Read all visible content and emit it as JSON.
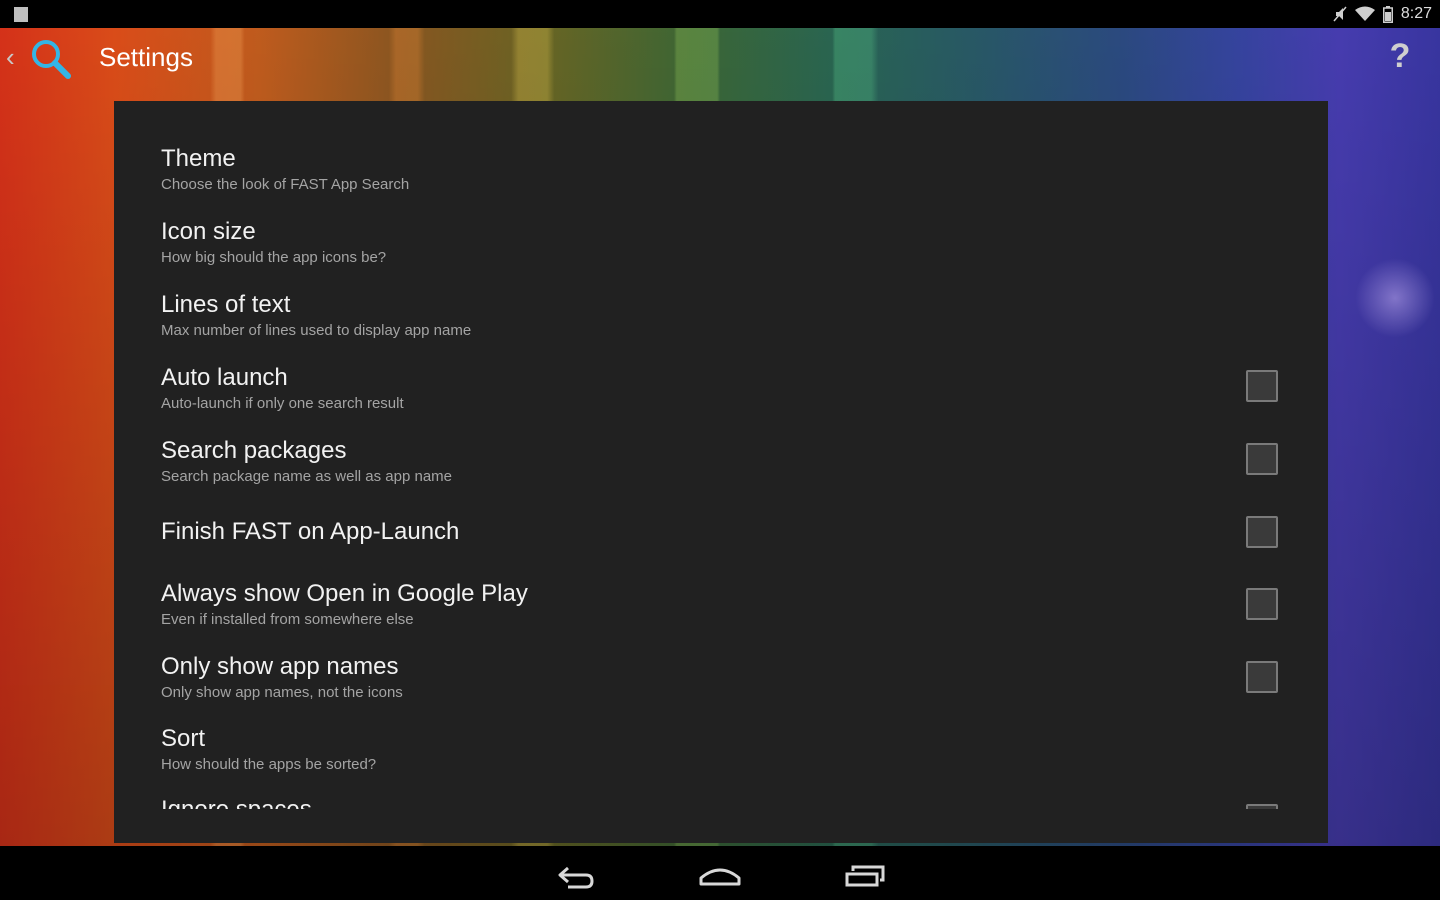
{
  "status_bar": {
    "time": "8:27",
    "icons": [
      "notification-icon",
      "mute-icon",
      "wifi-icon",
      "battery-icon"
    ]
  },
  "action_bar": {
    "up_icon": "chevron-left-icon",
    "app_icon": "search-icon",
    "title": "Settings",
    "help_label": "?"
  },
  "preferences": [
    {
      "title": "Theme",
      "summary": "Choose the look of FAST App Search",
      "checkbox": false
    },
    {
      "title": "Icon size",
      "summary": "How big should the app icons be?",
      "checkbox": false
    },
    {
      "title": "Lines of text",
      "summary": "Max number of lines used to display app name",
      "checkbox": false
    },
    {
      "title": "Auto launch",
      "summary": "Auto-launch if only one search result",
      "checkbox": true,
      "checked": false
    },
    {
      "title": "Search packages",
      "summary": "Search package name as well as app name",
      "checkbox": true,
      "checked": false
    },
    {
      "title": "Finish FAST on App-Launch",
      "summary": "",
      "checkbox": true,
      "checked": false
    },
    {
      "title": "Always show Open in Google Play",
      "summary": "Even if installed from somewhere else",
      "checkbox": true,
      "checked": false
    },
    {
      "title": "Only show app names",
      "summary": "Only show app names, not the icons",
      "checkbox": true,
      "checked": false
    },
    {
      "title": "Sort",
      "summary": "How should the apps be sorted?",
      "checkbox": false
    },
    {
      "title": "Ignore spaces",
      "summary": "",
      "checkbox": true,
      "checked": false
    }
  ],
  "nav_bar": {
    "icons": [
      "back-icon",
      "home-icon",
      "recent-apps-icon"
    ]
  },
  "colors": {
    "panel": "#212121",
    "accent": "#33b5e5"
  }
}
